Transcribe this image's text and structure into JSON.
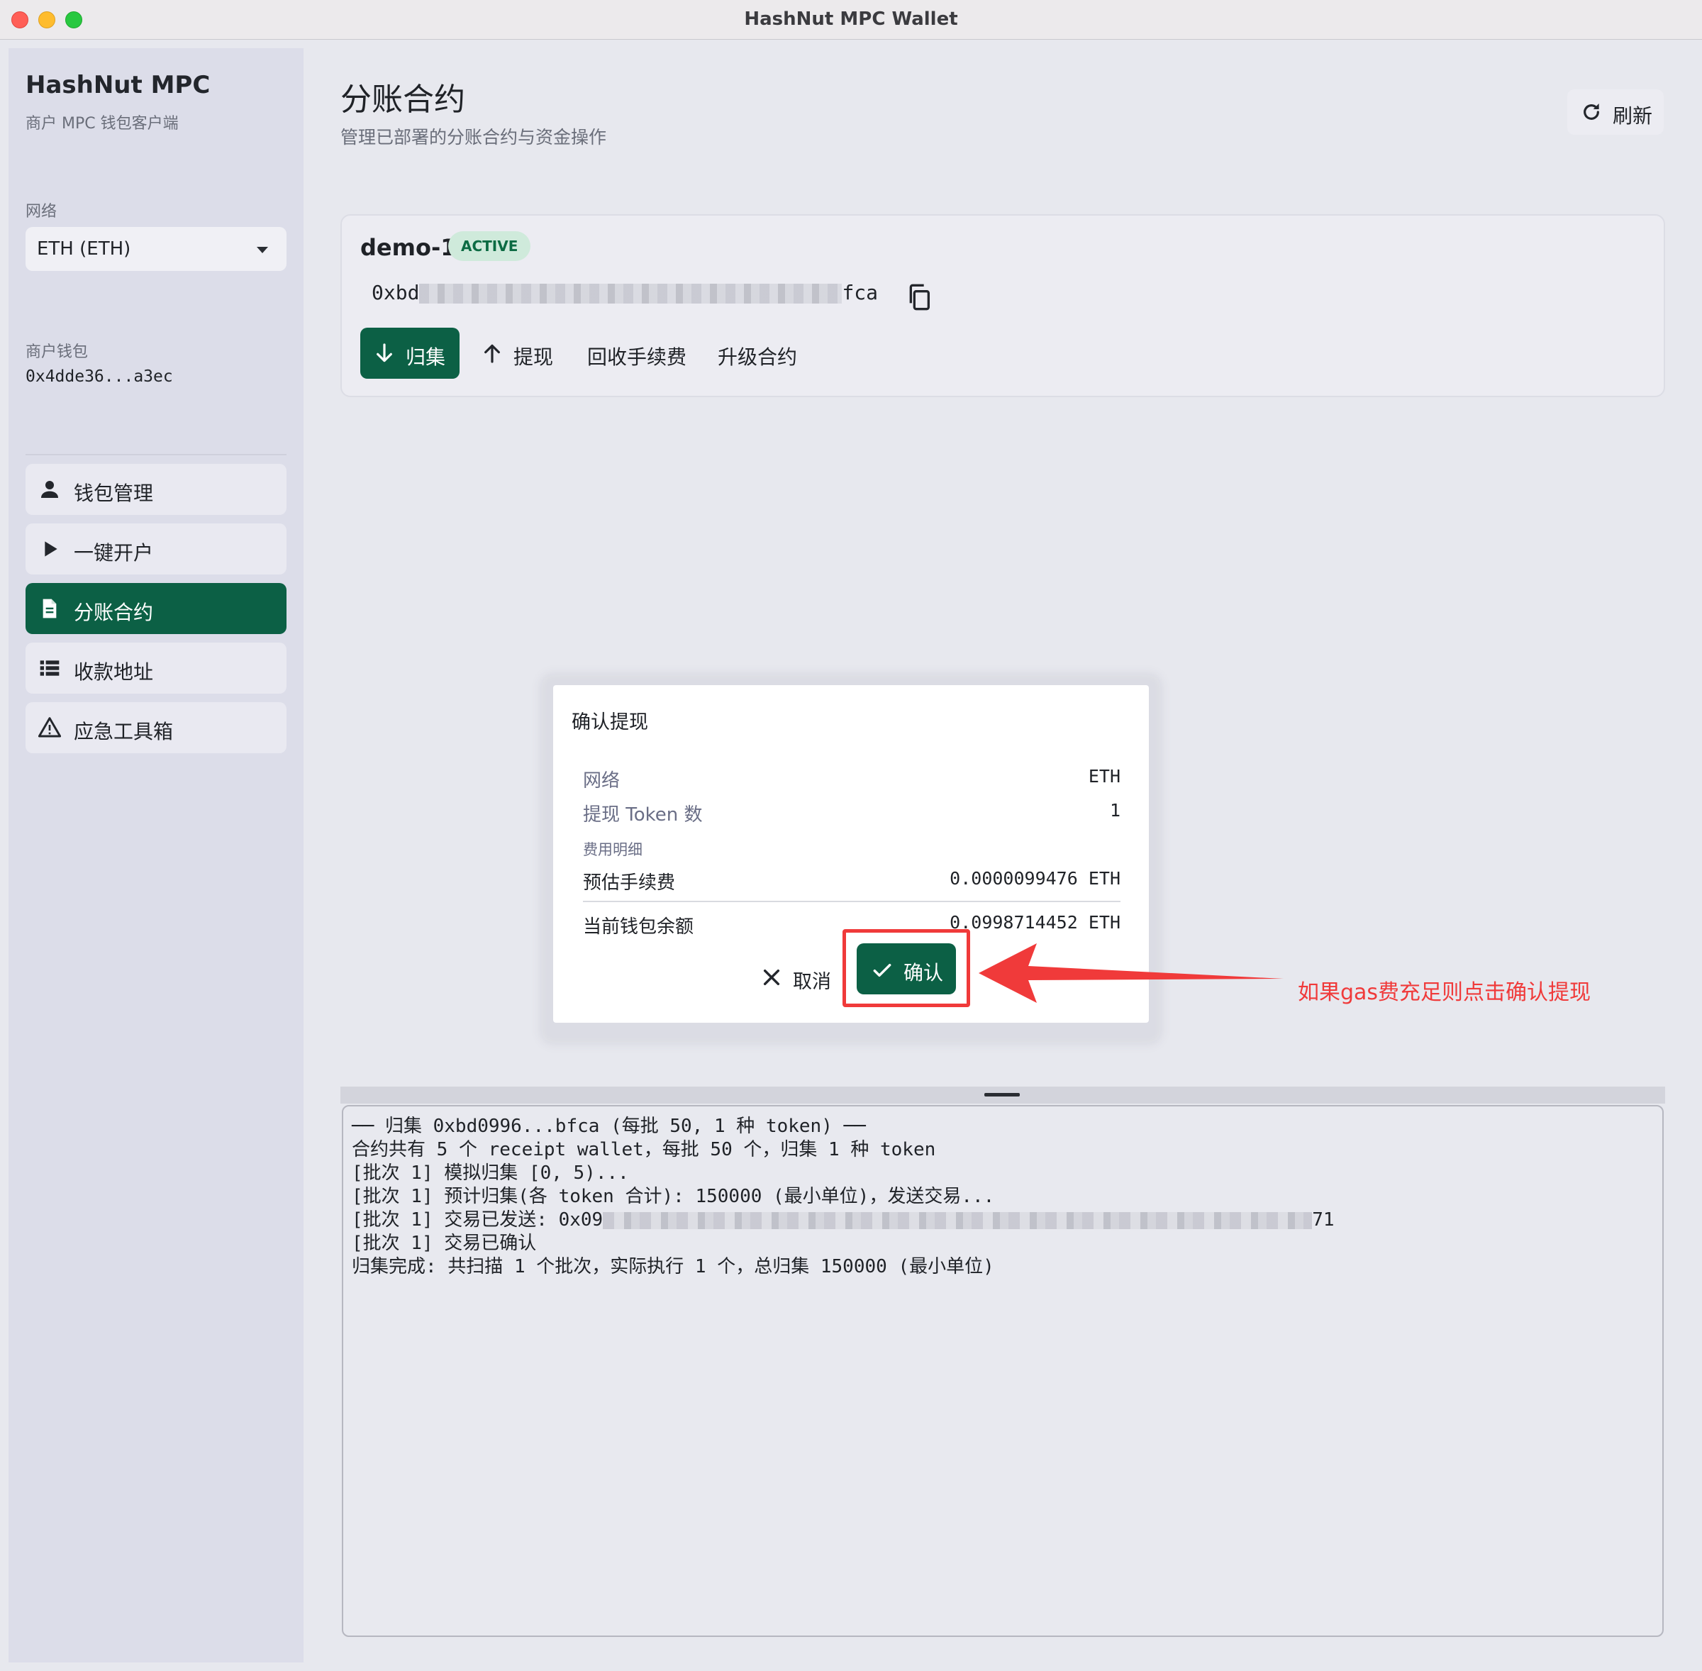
{
  "window": {
    "title": "HashNut MPC Wallet"
  },
  "sidebar": {
    "brand_title": "HashNut MPC",
    "brand_subtitle": "商户 MPC 钱包客户端",
    "network_label": "网络",
    "network_value": "ETH (ETH)",
    "wallet_label": "商户钱包",
    "wallet_address": "0x4dde36...a3ec",
    "items": [
      {
        "label": "钱包管理",
        "icon": "person-icon"
      },
      {
        "label": "一键开户",
        "icon": "play-icon"
      },
      {
        "label": "分账合约",
        "icon": "document-icon",
        "active": true
      },
      {
        "label": "收款地址",
        "icon": "list-icon"
      },
      {
        "label": "应急工具箱",
        "icon": "warning-icon"
      }
    ]
  },
  "header": {
    "title": "分账合约",
    "subtitle": "管理已部署的分账合约与资金操作",
    "refresh_label": "刷新"
  },
  "contract": {
    "name": "demo-1",
    "status": "ACTIVE",
    "address_prefix": "0xbd",
    "address_suffix": "fca",
    "actions": {
      "collect": "归集",
      "withdraw": "提现",
      "reclaim_fee": "回收手续费",
      "upgrade": "升级合约"
    }
  },
  "dialog": {
    "title": "确认提现",
    "network_label": "网络",
    "network_value": "ETH",
    "token_count_label": "提现 Token 数",
    "token_count_value": "1",
    "fee_section_label": "费用明细",
    "est_fee_label": "预估手续费",
    "est_fee_value": "0.0000099476 ETH",
    "balance_label": "当前钱包余额",
    "balance_value": "0.0998714452 ETH",
    "cancel_label": "取消",
    "confirm_label": "确认"
  },
  "annotation": {
    "text": "如果gas费充足则点击确认提现",
    "color": "#f03a3a"
  },
  "log": {
    "lines": [
      "── 归集 0xbd0996...bfca (每批 50, 1 种 token) ──",
      "合约共有 5 个 receipt wallet，每批 50 个，归集 1 种 token",
      "[批次 1] 模拟归集 [0, 5)...",
      "[批次 1] 预计归集(各 token 合计): 150000 (最小单位)，发送交易...",
      "[批次 1] 交易已确认",
      "归集完成: 共扫描 1 个批次，实际执行 1 个，总归集 150000 (最小单位)"
    ],
    "tx_sent_prefix": "[批次 1] 交易已发送: 0x09",
    "tx_sent_suffix": "71"
  },
  "colors": {
    "accent": "#0c6045",
    "badge_bg": "#cfeadb",
    "badge_text": "#0c6b43"
  }
}
